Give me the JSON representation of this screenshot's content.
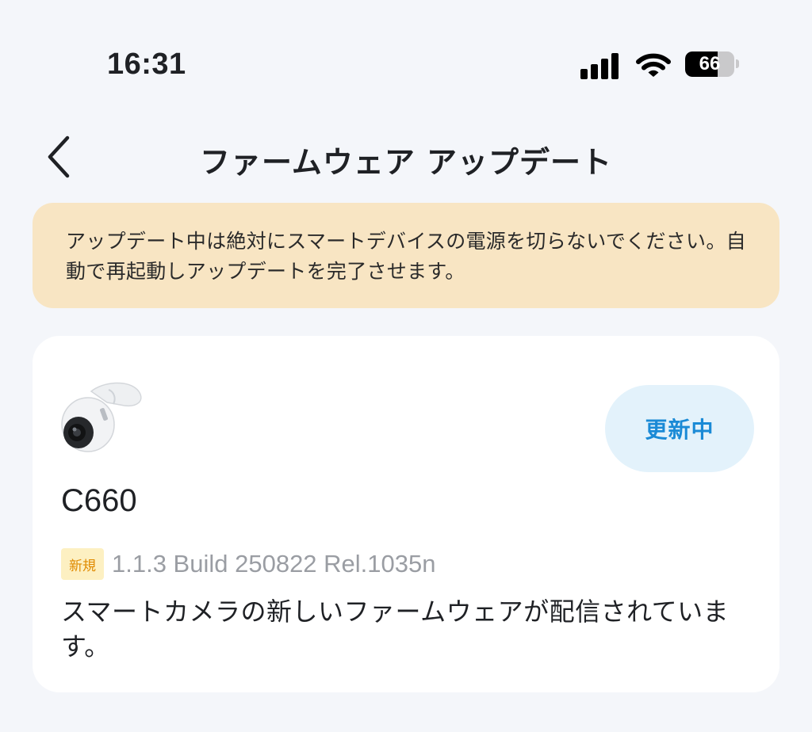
{
  "status_bar": {
    "time": "16:31",
    "battery_level": "66",
    "icons": [
      "signal-icon",
      "wifi-icon",
      "battery-icon"
    ]
  },
  "header": {
    "title": "ファームウェア アップデート",
    "back_icon": "chevron-left-icon"
  },
  "banner": {
    "text": "アップデート中は絶対にスマートデバイスの電源を切らないでください。自動で再起動しアップデートを完了させます。",
    "background": "#f8e5c3"
  },
  "device": {
    "model": "C660",
    "status_label": "更新中",
    "badge": "新規",
    "firmware_version": "1.1.3 Build 250822 Rel.1035n",
    "description": "スマートカメラの新しいファームウェアが配信されています。",
    "image_icon": "camera-icon"
  },
  "colors": {
    "page_bg": "#f4f6fa",
    "accent": "#1a8ad6",
    "status_button_bg": "#e3f2fb",
    "badge_bg": "#fdf0c2",
    "badge_text": "#e08a00"
  }
}
